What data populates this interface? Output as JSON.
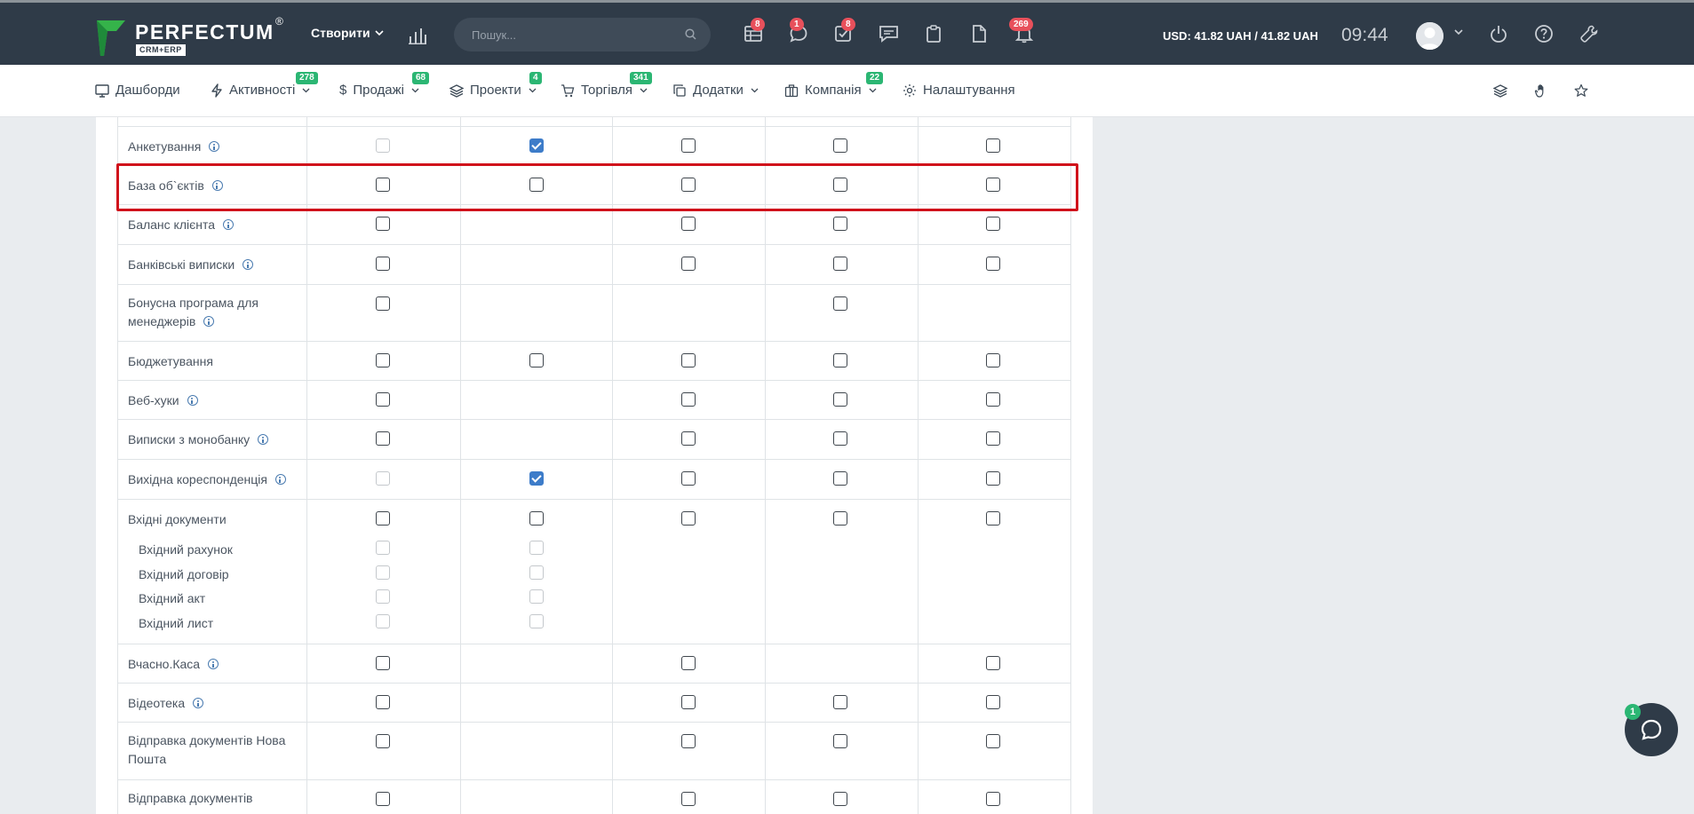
{
  "brand": {
    "name": "PERFECTUM",
    "registered": "®",
    "subtitle": "CRM+ERP"
  },
  "header": {
    "create_label": "Створити",
    "search_placeholder": "Пошук...",
    "badges": {
      "calendar": "8",
      "chat": "1",
      "tasks": "8",
      "notifications": "269"
    },
    "currency": "USD: 41.82 UAH / 41.82 UAH",
    "time": "09:44"
  },
  "nav": {
    "items": [
      {
        "label": "Дашборди"
      },
      {
        "label": "Активності",
        "badge": "278"
      },
      {
        "label": "Продажі",
        "badge": "68"
      },
      {
        "label": "Проекти",
        "badge": "4"
      },
      {
        "label": "Торгівля",
        "badge": "341"
      },
      {
        "label": "Додатки"
      },
      {
        "label": "Компанія",
        "badge": "22"
      },
      {
        "label": "Налаштування"
      }
    ]
  },
  "table": {
    "rows": [
      {
        "label": "Анкетування",
        "info": true,
        "cells": [
          "dis",
          "on",
          "off",
          "off",
          "off"
        ]
      },
      {
        "label": "База об`єктів",
        "info": true,
        "cells": [
          "off",
          "off",
          "off",
          "off",
          "off"
        ]
      },
      {
        "label": "Баланс клієнта",
        "info": true,
        "cells": [
          "off",
          "",
          "off",
          "off",
          "off"
        ]
      },
      {
        "label": "Банківські виписки",
        "info": true,
        "cells": [
          "off",
          "",
          "off",
          "off",
          "off"
        ]
      },
      {
        "label": "Бонусна програма для менеджерів",
        "info": true,
        "cells": [
          "off",
          "",
          "",
          "off",
          ""
        ]
      },
      {
        "label": "Бюджетування",
        "info": false,
        "cells": [
          "off",
          "off",
          "off",
          "off",
          "off"
        ]
      },
      {
        "label": "Веб-хуки",
        "info": true,
        "cells": [
          "off",
          "",
          "off",
          "off",
          "off"
        ]
      },
      {
        "label": "Виписки з монобанку",
        "info": true,
        "cells": [
          "off",
          "",
          "off",
          "off",
          "off"
        ]
      },
      {
        "label": "Вихідна кореспонденція",
        "info": true,
        "cells": [
          "dis",
          "on",
          "off",
          "off",
          "off"
        ]
      },
      {
        "label": "Вхідні документи",
        "info": false,
        "cells": [
          "off",
          "off",
          "off",
          "off",
          "off"
        ],
        "sub": [
          {
            "label": "Вхідний рахунок"
          },
          {
            "label": "Вхідний договір"
          },
          {
            "label": "Вхідний акт"
          },
          {
            "label": "Вхідний лист"
          }
        ]
      },
      {
        "label": "Вчасно.Каса",
        "info": true,
        "cells": [
          "off",
          "",
          "off",
          "",
          "off"
        ]
      },
      {
        "label": "Відеотека",
        "info": true,
        "cells": [
          "off",
          "",
          "off",
          "off",
          "off"
        ]
      },
      {
        "label": "Відправка документів Нова Пошта",
        "info": false,
        "cells": [
          "off",
          "",
          "off",
          "off",
          "off"
        ]
      },
      {
        "label": "Відправка документів",
        "info": false,
        "cells": [
          "off",
          "",
          "off",
          "off",
          "off"
        ]
      }
    ]
  },
  "chat": {
    "badge": "1"
  }
}
